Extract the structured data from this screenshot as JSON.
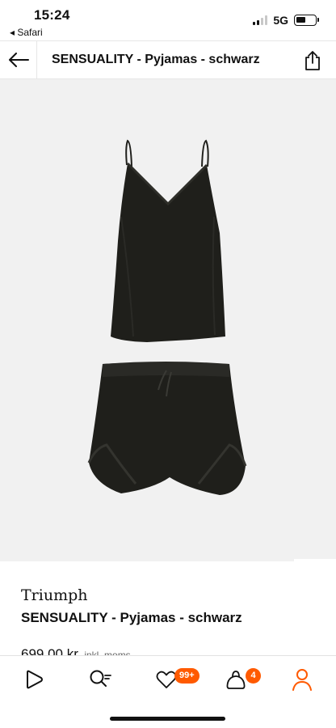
{
  "status_bar": {
    "time": "15:24",
    "back_app": "◂ Safari",
    "network": "5G"
  },
  "header": {
    "title": "SENSUALITY - Pyjamas - schwarz"
  },
  "gallery": {
    "active_index": 0,
    "image_count": 2
  },
  "product": {
    "brand": "Triumph",
    "name": "SENSUALITY - Pyjamas - schwarz",
    "price": "699,00 kr",
    "vat_note": "inkl. moms"
  },
  "bottom_nav": {
    "wishlist_badge": "99+",
    "bag_badge": "4"
  },
  "colors": {
    "accent": "#ff5a00",
    "garment": "#1f1f1b",
    "image_bg": "#f1f1f1"
  }
}
